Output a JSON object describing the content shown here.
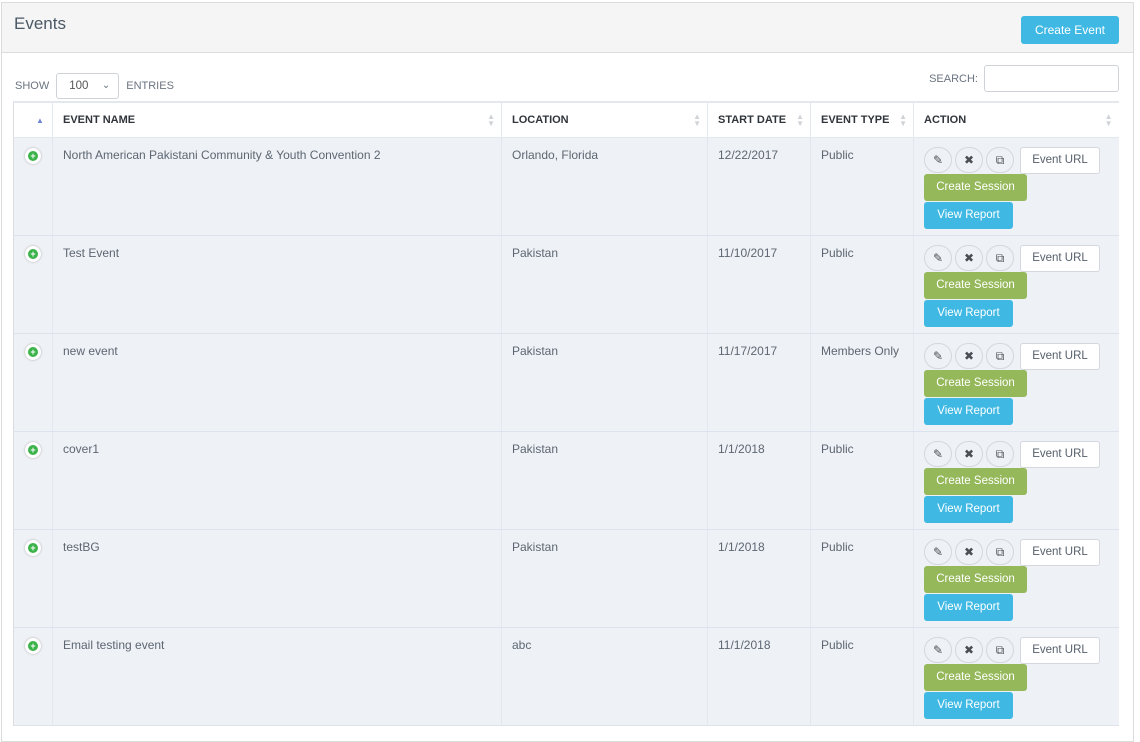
{
  "header": {
    "title": "Events",
    "create_button": "Create Event"
  },
  "controls": {
    "show_label": "SHOW",
    "entries_value": "100",
    "entries_label": "ENTRIES",
    "search_label": "SEARCH:",
    "search_value": "",
    "search_placeholder": ""
  },
  "columns": {
    "expand": "",
    "event_name": "EVENT NAME",
    "location": "LOCATION",
    "start_date": "START DATE",
    "event_type": "EVENT TYPE",
    "action": "ACTION"
  },
  "icons": {
    "sort_asc": "▲",
    "sort_up": "▲",
    "sort_down": "▼",
    "chevron": "⌄",
    "expand": "+",
    "edit": "✎",
    "delete": "✖",
    "copy": "⧉"
  },
  "actions": {
    "event_url": "Event URL",
    "create_session": "Create Session",
    "view_report": "View Report"
  },
  "colors": {
    "primary": "#3fb9e3",
    "success": "#95b85a",
    "expand_green": "#3cb34a",
    "row_bg": "#eef1f6"
  },
  "rows": [
    {
      "name": "North American Pakistani Community & Youth Convention 2",
      "location": "Orlando, Florida",
      "start_date": "12/22/2017",
      "type": "Public"
    },
    {
      "name": "Test Event",
      "location": "Pakistan",
      "start_date": "11/10/2017",
      "type": "Public"
    },
    {
      "name": "new event",
      "location": "Pakistan",
      "start_date": "11/17/2017",
      "type": "Members Only"
    },
    {
      "name": "cover1",
      "location": "Pakistan",
      "start_date": "1/1/2018",
      "type": "Public"
    },
    {
      "name": "testBG",
      "location": "Pakistan",
      "start_date": "1/1/2018",
      "type": "Public"
    },
    {
      "name": "Email testing event",
      "location": "abc",
      "start_date": "11/1/2018",
      "type": "Public"
    }
  ]
}
